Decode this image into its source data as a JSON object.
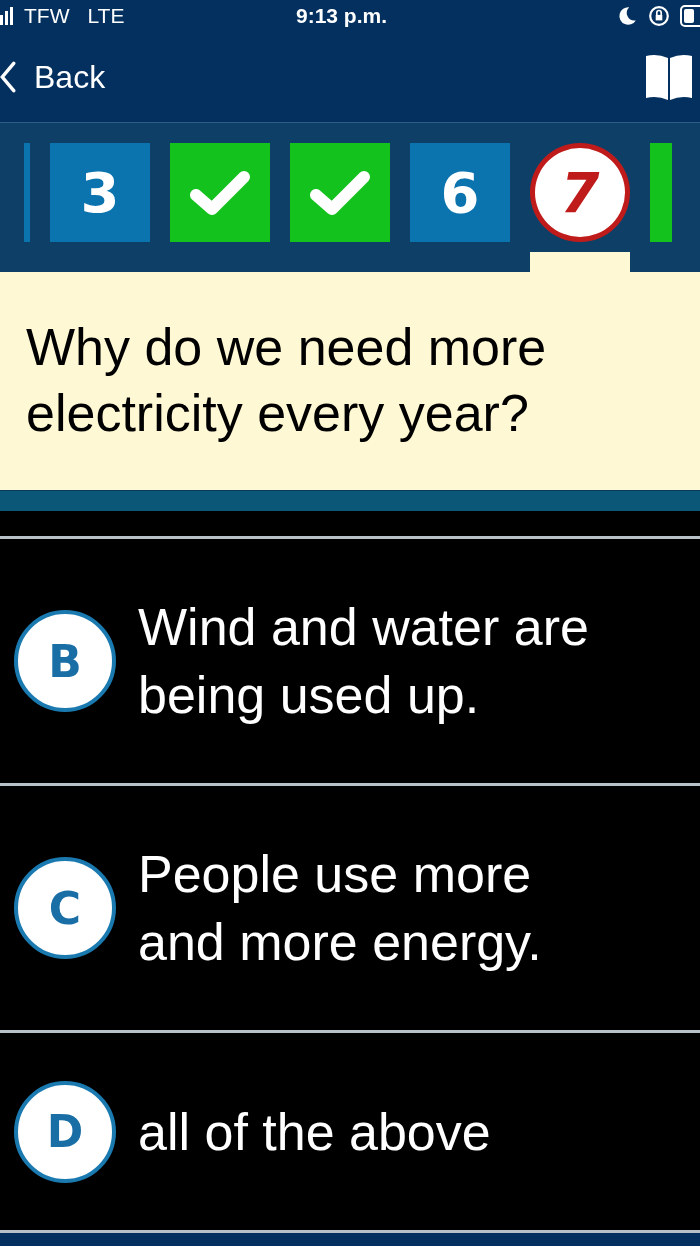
{
  "status_bar": {
    "carrier": "TFW",
    "network": "LTE",
    "time": "9:13 p.m."
  },
  "nav": {
    "back_label": "Back"
  },
  "question_tiles": [
    {
      "kind": "number",
      "partial": true,
      "selected": false
    },
    {
      "kind": "number",
      "label": "3",
      "partial": false,
      "selected": false
    },
    {
      "kind": "correct",
      "partial": false,
      "selected": false
    },
    {
      "kind": "correct",
      "partial": false,
      "selected": false
    },
    {
      "kind": "number",
      "label": "6",
      "partial": false,
      "selected": false
    },
    {
      "kind": "number",
      "label": "7",
      "partial": false,
      "selected": true
    },
    {
      "kind": "correct",
      "partial": true,
      "selected": false
    }
  ],
  "question": "Why do we need more electricity every year?",
  "answers": [
    {
      "letter": "B",
      "text": "Wind and water are being used up."
    },
    {
      "letter": "C",
      "text": "People use more and more energy."
    },
    {
      "letter": "D",
      "text": "all of the above"
    }
  ]
}
